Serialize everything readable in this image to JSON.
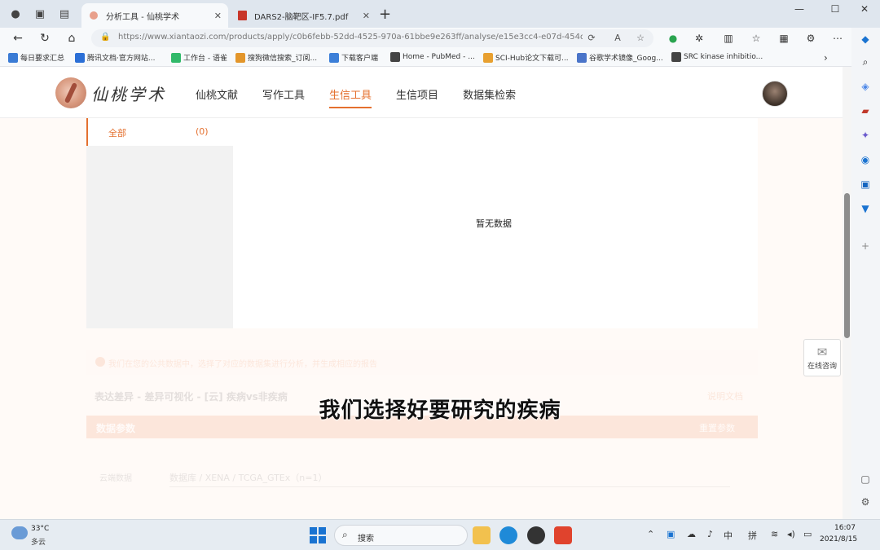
{
  "browser": {
    "tabs": [
      {
        "title": "分析工具 - 仙桃学术",
        "active": true
      },
      {
        "title": "DARS2-脑靶区-IF5.7.pdf",
        "active": false
      }
    ],
    "url": "https://www.xiantaozi.com/products/apply/c0b6febb-52dd-4525-970a-61bbe9e263ff/analyse/e15e3cc4-e07d-454d-8df...",
    "bookmarks": [
      "每日要求汇总",
      "腾讯文档·官方网站...",
      "工作台 - 语雀",
      "搜狗微信搜索_订阅...",
      "下载客户端",
      "Home - PubMed - ...",
      "SCI-Hub论文下载可...",
      "谷歌学术镜像_Goog...",
      "SRC kinase inhibitio..."
    ]
  },
  "site": {
    "logo_text": "仙桃学术",
    "nav": [
      {
        "label": "仙桃文献",
        "active": false
      },
      {
        "label": "写作工具",
        "active": false
      },
      {
        "label": "生信工具",
        "active": true
      },
      {
        "label": "生信项目",
        "active": false
      },
      {
        "label": "数据集检索",
        "active": false
      }
    ]
  },
  "filter": {
    "all_label": "全部",
    "all_count": "(0)",
    "empty_text": "暂无数据"
  },
  "tool": {
    "notice": "我们在您的公共数据中，选择了对应的数据集进行分析，并生成相应的报告",
    "section_title": "表达差异 - 差异可视化 - [云] 疾病vs非疾病",
    "section_link": "说明文档",
    "params_title": "数据参数",
    "params_reset": "重置参数",
    "field_label": "云端数据",
    "field_value": "数据库 / XENA / TCGA_GTEx（n=1）"
  },
  "subtitle": "我们选择好要研究的疾病",
  "consult_label": "在线咨询",
  "taskbar": {
    "weather_temp": "33°C",
    "weather_desc": "多云",
    "search_label": "搜索",
    "ime": "中",
    "ime2": "拼",
    "time": "16:07",
    "date": "2021/8/15"
  },
  "colors": {
    "accent": "#e4702f",
    "page_bg": "#fffaf7",
    "taskbar_bg": "#e6ecf2"
  }
}
